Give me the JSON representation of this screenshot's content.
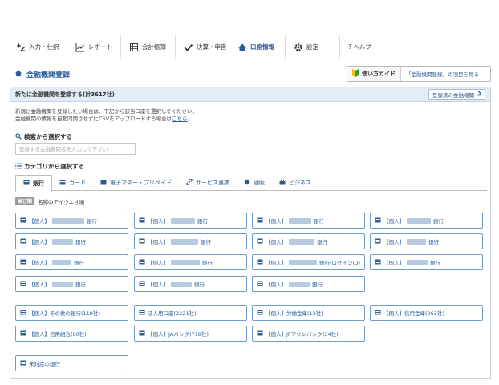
{
  "nav": {
    "items": [
      {
        "label": "入力・仕訳",
        "icon": "plus-minus-icon"
      },
      {
        "label": "レポート",
        "icon": "chart-line-icon"
      },
      {
        "label": "会計帳簿",
        "icon": "ledger-icon"
      },
      {
        "label": "決算・申告",
        "icon": "check-icon"
      },
      {
        "label": "口座情報",
        "icon": "home-icon"
      },
      {
        "label": "設定",
        "icon": "gear-icon"
      },
      {
        "label": "? ヘルプ",
        "icon": "help-icon"
      }
    ],
    "active_index": 4
  },
  "page": {
    "title": "金融機関登録"
  },
  "guide": {
    "label": "使い方ガイド",
    "link": "「金融機関登録」の項目を見る"
  },
  "panel": {
    "title": "新たに金融機関を登録する(計3617社)",
    "registered_button": "登録済み金融機関",
    "desc_line1": "新規に金融機関を登録したい場合は、下記から該当口座を選択してください。",
    "desc_line2_prefix": "金融機関の情報を自動同期させずにCSVをアップロードする場合は",
    "desc_line2_link": "こちら",
    "desc_line2_suffix": "。"
  },
  "search": {
    "title": "検索から選択する",
    "placeholder": "登録する金融機関名を入力して下さい"
  },
  "category": {
    "title": "カテゴリから選択する",
    "tabs": [
      "銀行",
      "カード",
      "電子マネー・プリペイド",
      "サービス連携",
      "通販",
      "ビジネス"
    ],
    "active_index": 0
  },
  "sort": {
    "badge": "並び順",
    "label": "名称のアイウエオ順"
  },
  "banks": [
    {
      "prefix": "【個人】",
      "suffix": "銀行"
    },
    {
      "prefix": "【個人】",
      "suffix": "銀行"
    },
    {
      "prefix": "【個人】",
      "suffix": "銀行"
    },
    {
      "prefix": "【個人】",
      "suffix": "銀行"
    },
    {
      "prefix": "【個人】",
      "suffix": "銀行"
    },
    {
      "prefix": "【個人】",
      "suffix": "銀行"
    },
    {
      "prefix": "【個人】",
      "suffix": "銀行"
    },
    {
      "prefix": "【個人】",
      "suffix": "銀行"
    },
    {
      "prefix": "【個人】",
      "suffix": "銀行"
    },
    {
      "prefix": "【個人】",
      "suffix": "銀行"
    },
    {
      "prefix": "【個人】",
      "suffix": "銀行(ログインID)"
    },
    {
      "prefix": "【個人】",
      "suffix": "銀行"
    },
    {
      "prefix": "【個人】",
      "suffix": "銀行"
    },
    {
      "prefix": "【個人】",
      "suffix": "銀行"
    },
    {
      "prefix": "【個人】",
      "suffix": "銀行"
    }
  ],
  "groups": [
    {
      "label": "【個人】その他の銀行(119社)"
    },
    {
      "label": "法人用口座(2221社)"
    },
    {
      "label": "【個人】労働金庫(13社)"
    },
    {
      "label": "【個人】信用金庫(263社)"
    },
    {
      "label": "【個人】信用組合(80社)"
    },
    {
      "label": "【個人】JAバンク(718社)"
    },
    {
      "label": "【個人】JFマリンバンク(34社)"
    }
  ],
  "unsupported": {
    "label": "未対応の銀行"
  },
  "colors": {
    "accent": "#2a5d9a",
    "header_bg": "#e3ecf5",
    "button_border": "#6e9bc7"
  }
}
